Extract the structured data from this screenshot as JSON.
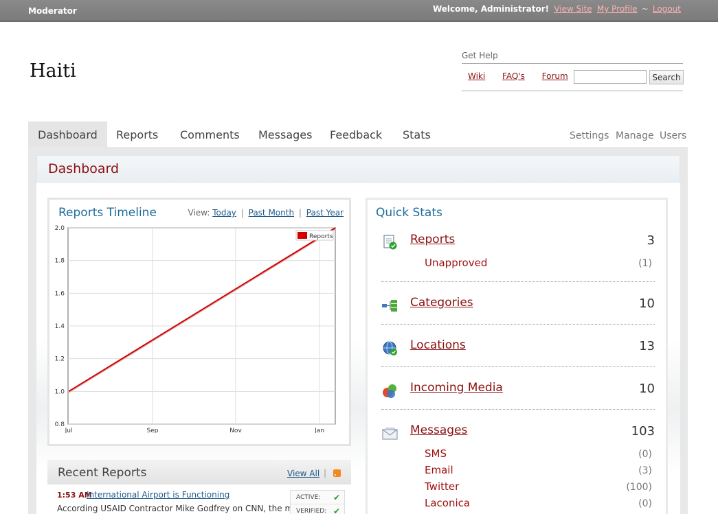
{
  "topbar": {
    "brand": "Moderator",
    "welcome": "Welcome, Administrator!",
    "view_site": "View Site",
    "my_profile": "My Profile",
    "separator": "~",
    "logout": "Logout"
  },
  "site_title": "Haiti",
  "help": {
    "label": "Get Help",
    "links": [
      "Wiki",
      "FAQ's",
      "Forum"
    ],
    "search_button": "Search",
    "search_placeholder": ""
  },
  "nav": {
    "tabs": [
      "Dashboard",
      "Reports",
      "Comments",
      "Messages",
      "Feedback",
      "Stats"
    ],
    "active": "Dashboard",
    "secondary": [
      "Settings",
      "Manage",
      "Users"
    ]
  },
  "page_heading": "Dashboard",
  "timeline": {
    "title": "Reports Timeline",
    "view_label": "View:",
    "view_options": [
      "Today",
      "Past Month",
      "Past Year"
    ],
    "separator": "|"
  },
  "chart_data": {
    "type": "line",
    "x": [
      "Jul",
      "Sep",
      "Nov",
      "Jan"
    ],
    "series": [
      {
        "name": "Reports",
        "points": [
          [
            "Jul",
            1.0
          ],
          [
            "Jan+",
            2.0
          ]
        ]
      }
    ],
    "ylim": [
      0.8,
      2.0
    ],
    "yticks": [
      "2.0",
      "1.8",
      "1.6",
      "1.4",
      "1.2",
      "1.0",
      "0.8"
    ],
    "xticks": [
      "Jul",
      "Sep",
      "Nov",
      "Jan"
    ],
    "grid": true,
    "legend": "top-right",
    "color": "#d40000"
  },
  "recent_reports": {
    "title": "Recent Reports",
    "view_all": "View All",
    "separator": "|",
    "items": [
      {
        "time": "1:53 AM",
        "title": "International Airport is Functioning",
        "desc": "According USAID Contractor Mike Godfrey on CNN, the main",
        "status": [
          {
            "label": "ACTIVE:",
            "ok": "✔"
          },
          {
            "label": "VERIFIED:",
            "ok": "✔"
          }
        ]
      }
    ]
  },
  "quick_stats": {
    "title": "Quick Stats",
    "reports": {
      "label": "Reports",
      "count": "3",
      "icon": "report-check-icon",
      "sub": [
        {
          "label": "Unapproved",
          "value": "(1)"
        }
      ]
    },
    "categories": {
      "label": "Categories",
      "count": "10",
      "icon": "categories-tree-icon"
    },
    "locations": {
      "label": "Locations",
      "count": "13",
      "icon": "globe-icon"
    },
    "media": {
      "label": "Incoming Media",
      "count": "10",
      "icon": "media-bubbles-icon"
    },
    "messages": {
      "label": "Messages",
      "count": "103",
      "icon": "envelope-icon",
      "sub": [
        {
          "label": "SMS",
          "value": "(0)"
        },
        {
          "label": "Email",
          "value": "(3)"
        },
        {
          "label": "Twitter",
          "value": "(100)"
        },
        {
          "label": "Laconica",
          "value": "(0)"
        }
      ]
    }
  }
}
